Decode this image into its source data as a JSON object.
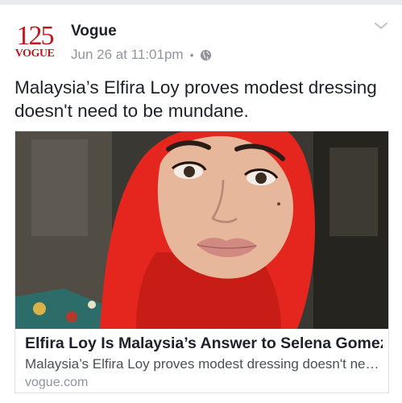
{
  "post": {
    "page_name": "Vogue",
    "avatar": {
      "number": "125",
      "brand": "VOGUE"
    },
    "timestamp": "Jun 26 at 11:01pm",
    "separator": "•",
    "privacy_icon": "globe-icon",
    "menu_icon": "chevron-down-icon",
    "text": "Malaysia’s Elfira Loy proves modest dressing doesn't need to be mundane.",
    "link": {
      "image_icon": "photo-hijab-portrait",
      "title": "Elfira Loy Is Malaysia’s Answer to Selena Gomez",
      "description": "Malaysia’s Elfira Loy proves modest dressing doesn't nee...",
      "domain": "vogue.com"
    }
  },
  "colors": {
    "brand_red": "#c4161c",
    "text": "#1d2129",
    "meta": "#90949c",
    "hijab": "#e5261f"
  }
}
